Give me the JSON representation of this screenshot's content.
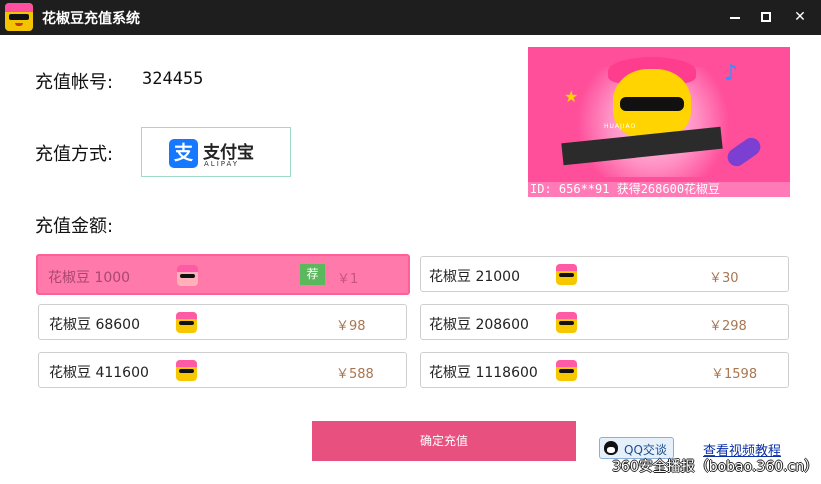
{
  "window": {
    "title": "花椒豆充值系统",
    "controls": {
      "minimize_icon": "minimize-icon",
      "maximize_icon": "maximize-icon",
      "close_icon": "close-icon",
      "close_glyph": "✕"
    },
    "app_icon": "huajiao-mascot-icon"
  },
  "form": {
    "account_label": "充值帐号:",
    "account_value": "324455",
    "method_label": "充值方式:",
    "amount_label": "充值金额:"
  },
  "payment_method": {
    "logo_glyph": "支",
    "name": "支付宝",
    "name_en": "ALIPAY",
    "accent": "#1677ff"
  },
  "banner": {
    "band_text": "HUAJIAO",
    "ticker": "ID: 656**91 获得268600花椒豆"
  },
  "options": [
    {
      "name": "花椒豆  1000",
      "price": "￥1",
      "selected": true,
      "recommend": "荐"
    },
    {
      "name": "花椒豆  21000",
      "price": "￥30",
      "selected": false
    },
    {
      "name": "花椒豆  68600",
      "price": "￥98",
      "selected": false
    },
    {
      "name": "花椒豆  208600",
      "price": "￥298",
      "selected": false
    },
    {
      "name": "花椒豆  411600",
      "price": "￥588",
      "selected": false
    },
    {
      "name": "花椒豆  1118600",
      "price": "￥1598",
      "selected": false
    }
  ],
  "actions": {
    "confirm": "确定充值",
    "qq_chat": "QQ交谈",
    "tutorial": "查看视频教程"
  },
  "watermark": "360安全播报（bobao.360.cn）",
  "colors": {
    "titlebar": "#1e1e1e",
    "selected_option": "#ff79ab",
    "confirm_button": "#e8507f",
    "recommend_badge": "#5cb85c"
  }
}
